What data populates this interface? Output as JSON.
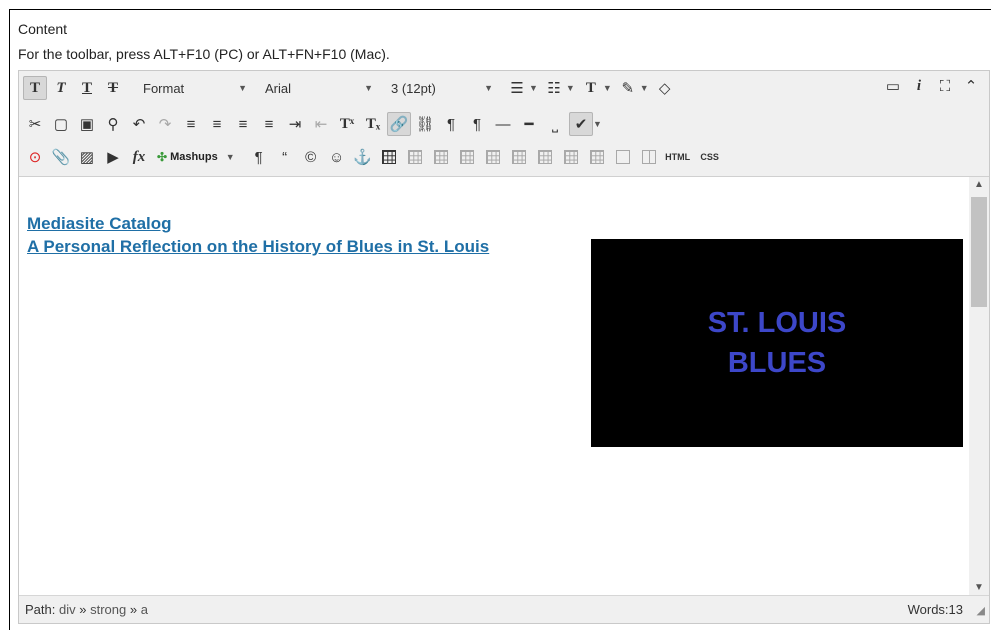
{
  "field_label": "Content",
  "toolbar_hint": "For the toolbar, press ALT+F10 (PC) or ALT+FN+F10 (Mac).",
  "toolbar": {
    "row1": {
      "format_label": "Format",
      "font_label": "Arial",
      "size_label": "3 (12pt)"
    },
    "row3": {
      "mashups_label": "Mashups",
      "html_label": "HTML",
      "css_label": "CSS"
    }
  },
  "content": {
    "link1": "Mediasite Catalog",
    "link2": "A Personal Reflection on the History of Blues in St. Louis",
    "video_title_line1": "ST. LOUIS",
    "video_title_line2": "BLUES"
  },
  "status": {
    "path_label": "Path:",
    "path_nodes": [
      "div",
      "strong",
      "a"
    ],
    "path_sep": "»",
    "words": "Words:13"
  },
  "colors": {
    "link": "#1f6fa6",
    "video_text": "#3d47c9",
    "toolbar_bg": "#f0f0f0"
  }
}
